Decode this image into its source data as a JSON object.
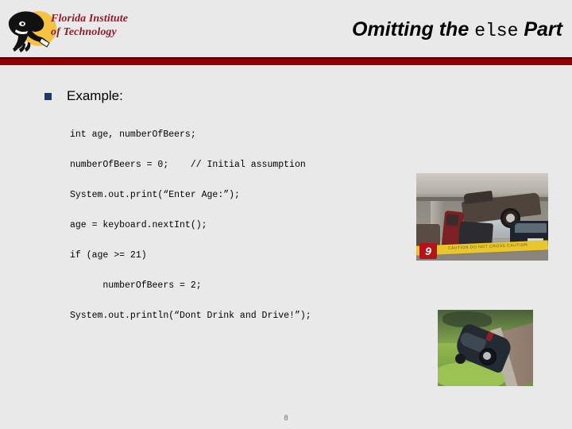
{
  "slide": {
    "background_color": "#e9e9e9",
    "page_number": "8"
  },
  "header": {
    "logo": {
      "icon_name": "florida-tech-panther-logo",
      "wordmark_line1": "Florida Institute",
      "wordmark_line2": "of Technology",
      "wordmark_color": "#8e1b2b",
      "circle_color": "#f5c243"
    },
    "title": {
      "part1": "Omitting the ",
      "keyword": "else",
      "part2": " Part"
    },
    "rule_color": "#8e0000"
  },
  "content": {
    "bullet": {
      "marker_color": "#1f3864",
      "label": "Example:"
    },
    "code_lines": [
      "int age, numberOfBeers;",
      "numberOfBeers = 0;    // Initial assumption",
      "System.out.print(“Enter Age:”);",
      "age = keyboard.nextInt();",
      "if (age >= 21)",
      "      numberOfBeers = 2;",
      "System.out.println(“Dont Drink and Drive!”);"
    ]
  },
  "photos": {
    "garage": {
      "alt": "Pickup truck crashed against parking garage ceiling over an overturned red car behind yellow caution tape",
      "tape_text": "CAUTION DO NOT CROSS CAUTION",
      "news_logo": "9"
    },
    "pond": {
      "alt": "Dark car nose-down in an algae covered pond beside a concrete curb and walking path"
    }
  }
}
